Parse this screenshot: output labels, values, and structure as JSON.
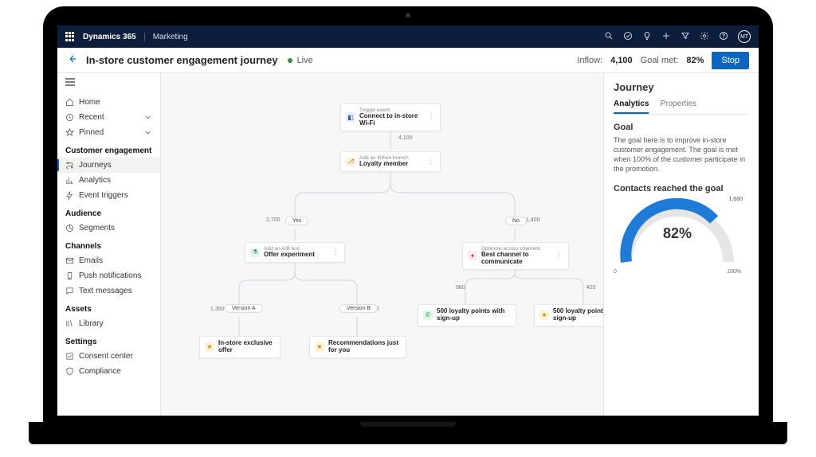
{
  "top": {
    "brand": "Dynamics 365",
    "app": "Marketing",
    "avatar": "MT"
  },
  "cmd": {
    "title": "In-store customer engagement journey",
    "status": "Live",
    "inflow_label": "Inflow:",
    "inflow_value": "4,100",
    "goal_label": "Goal met:",
    "goal_value": "82%",
    "stop": "Stop"
  },
  "nav": {
    "home": "Home",
    "recent": "Recent",
    "pinned": "Pinned",
    "s1": "Customer engagement",
    "journeys": "Journeys",
    "analytics": "Analytics",
    "event_triggers": "Event triggers",
    "s2": "Audience",
    "segments": "Segments",
    "s3": "Channels",
    "emails": "Emails",
    "push": "Push notifications",
    "text": "Text messages",
    "s4": "Assets",
    "library": "Library",
    "s5": "Settings",
    "consent": "Consent center",
    "compliance": "Compliance"
  },
  "flow": {
    "root": "4,100",
    "yes": "Yes",
    "yes_ct": "2,700",
    "no": "No",
    "no_ct": "1,400",
    "va": "Version A",
    "va_ct": "1,350",
    "vb": "Version B",
    "vb_ct": "1,350",
    "ch_a": "980",
    "ch_b": "420"
  },
  "cards": {
    "trigger_h": "Trigger event",
    "trigger_t": "Connect to in-store Wi-Fi",
    "branch_h": "Add an if/then branch",
    "branch_t": "Loyalty member",
    "ab_h": "Add an A/B test",
    "ab_t": "Offer experiment",
    "opt_h": "Optimize across channels",
    "opt_t": "Best channel to communicate",
    "leaf_exclusive": "In-store exclusive offer",
    "leaf_reco": "Recommendations just for you",
    "leaf_points": "500 loyalty points with sign-up"
  },
  "panel": {
    "title": "Journey",
    "tab_analytics": "Analytics",
    "tab_props": "Properties",
    "goal_h": "Goal",
    "goal_desc": "The goal here is to improve in-store customer engagement. The goal is met when 100% of the customer participate in the promotion.",
    "contacts_h": "Contacts reached the goal",
    "gauge_pct": "82%",
    "gauge_min": "0",
    "gauge_max": "100%",
    "gauge_top": "1,680"
  },
  "chart_data": {
    "type": "gauge",
    "title": "Contacts reached the goal",
    "value_pct": 82,
    "value_count": 1680,
    "min": 0,
    "max": 100,
    "unit": "%"
  }
}
